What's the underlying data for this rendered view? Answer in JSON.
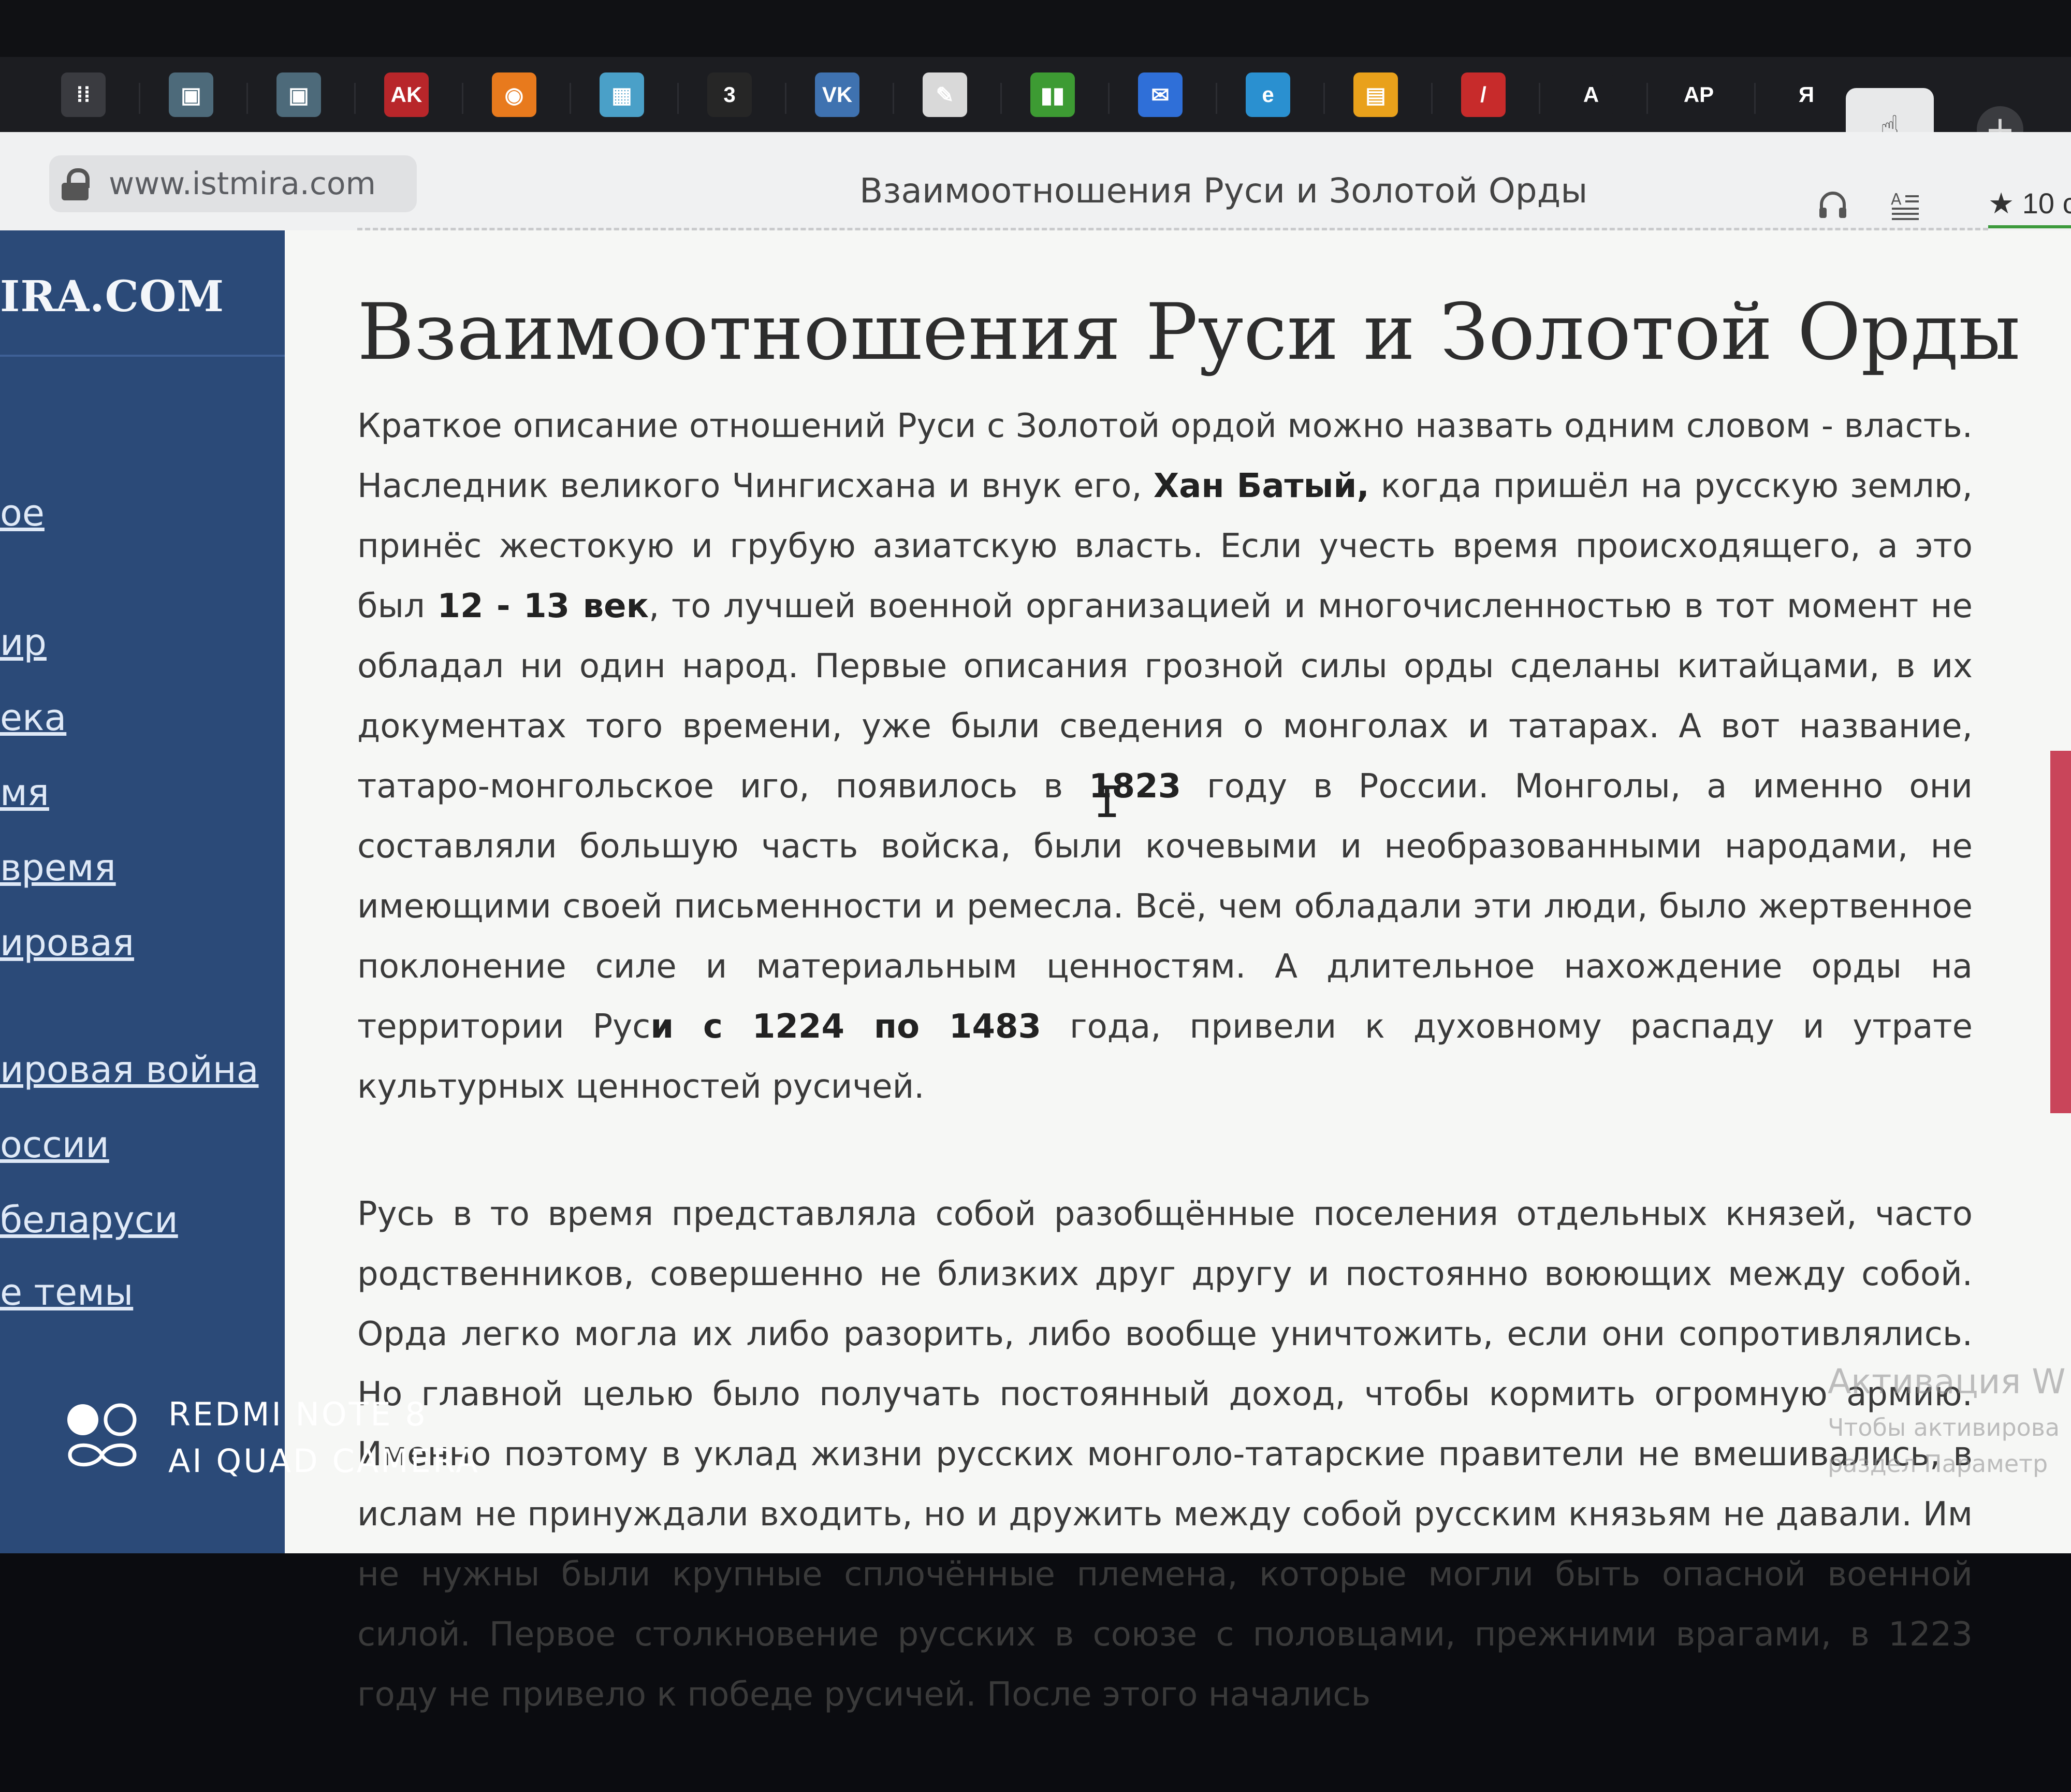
{
  "taskbar": {
    "icons": [
      {
        "name": "apps-grid-icon",
        "glyph": "⁞⁞",
        "color": "#3a3b40"
      },
      {
        "name": "bus-icon",
        "glyph": "▣",
        "color": "#4d6a7a"
      },
      {
        "name": "bus-icon-2",
        "glyph": "▣",
        "color": "#4d6a7a"
      },
      {
        "name": "ak-icon",
        "glyph": "AK",
        "color": "#b8262a"
      },
      {
        "name": "ok-icon",
        "glyph": "◉",
        "color": "#e87a1d"
      },
      {
        "name": "calendar-icon",
        "glyph": "▦",
        "color": "#4aa0c8"
      },
      {
        "name": "three-icon",
        "glyph": "3",
        "color": "#262626"
      },
      {
        "name": "vk-icon",
        "glyph": "VK",
        "color": "#3f72b0"
      },
      {
        "name": "doc-icon",
        "glyph": "✎",
        "color": "#d9d9d9"
      },
      {
        "name": "book-icon",
        "glyph": "▮▮",
        "color": "#3d9b33"
      },
      {
        "name": "mail-icon",
        "glyph": "✉",
        "color": "#2f6fd8"
      },
      {
        "name": "edge-icon",
        "glyph": "e",
        "color": "#2a90d0"
      },
      {
        "name": "news-icon",
        "glyph": "▤",
        "color": "#e9a11b"
      },
      {
        "name": "pen-icon",
        "glyph": "/",
        "color": "#c72b2b"
      },
      {
        "name": "letter-a-icon",
        "glyph": "A",
        "color": "#1c1d21"
      },
      {
        "name": "ar-icon",
        "glyph": "AP",
        "color": "#1c1d21"
      },
      {
        "name": "yandex-icon",
        "glyph": "Я",
        "color": "#1c1d21"
      }
    ],
    "active_tab_icon": "hand-pointer-icon",
    "new_tab_label": "+"
  },
  "address_bar": {
    "url": "www.istmira.com",
    "page_title": "Взаимоотношения Руси и Золотой Орды",
    "rating": "★ 10 с"
  },
  "sidebar": {
    "logo": "IRA.COM",
    "links": [
      "ое",
      "ир",
      "ека",
      "мя",
      " время",
      "ировая",
      "ировая война",
      "оссии",
      "беларуси",
      "е темы"
    ]
  },
  "article": {
    "title": "Взаимоотношения Руси и Золотой Орды",
    "p1": {
      "t1": "Краткое описание отношений Руси с Золотой ордой можно назвать одним словом - власть. Наследник великого Чингисхана и внук его, ",
      "b1": "Хан Батый,",
      "t2": " когда пришёл на русскую землю, принёс жестокую и грубую азиатскую власть. Если учесть время происходящего, а это был ",
      "b2": "12 - 13 век",
      "t3": ", то лучшей военной организацией и многочисленностью в тот момент не обладал ни один народ. Первые описания грозной силы орды сделаны китайцами, в их документах того времени, уже были сведения о монголах и татарах. А вот название, татаро-монгольское иго, появилось в ",
      "b3": "1823",
      "t4": " году в России. Монголы, а именно они составляли большую часть войска, были кочевыми и необразованными народами, не имеющими своей письменности и ремесла. Всё, чем обладали эти люди, было жертвенное поклонение силе и материальным ценностям. А длительное нахождение орды на территории Рус",
      "b4": "и с 1224 по 1483",
      "t5": " года, привели к духовному распаду и утрате культурных ценностей русичей."
    },
    "p2": "Русь в то время представляла собой разобщённые поселения отдельных князей, часто родственников, совершенно не близких друг другу и постоянно воюющих между собой. Орда легко могла их либо разорить, либо вообще уничтожить, если они сопротивлялись. Но главной целью было получать постоянный доход, чтобы кормить огромную армию. Именно поэтому в уклад жизни русских монголо-татарские правители не вмешивались, в ислам не принуждали входить, но и дружить между собой русским князьям не давали. Им не нужны были крупные сплочённые племена, которые могли быть опасной военной силой. Первое столкновение русских в союзе с половцами, прежними врагами, в 1223 году не привело к победе русичей. После этого начались"
  },
  "watermark": {
    "line1": "Активация W",
    "line2": "Чтобы активирова",
    "line3": "раздел Параметр"
  },
  "camera": {
    "line1": "REDMI NOTE 8",
    "line2": "AI QUAD CAMERA"
  }
}
